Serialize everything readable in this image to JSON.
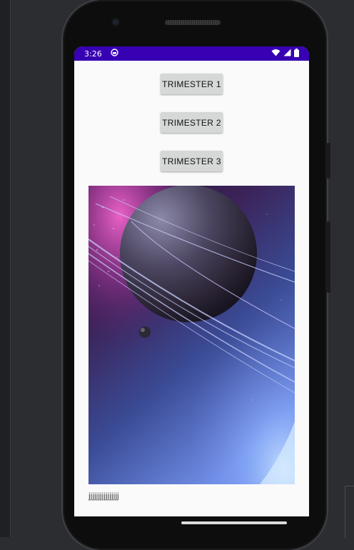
{
  "status_bar": {
    "time": "3:26",
    "bg_color": "#3700b3",
    "icons": [
      "notification-icon",
      "wifi-icon",
      "signal-icon",
      "battery-icon"
    ]
  },
  "buttons": [
    {
      "label": "TRIMESTER 1"
    },
    {
      "label": "TRIMESTER 2"
    },
    {
      "label": "TRIMESTER 3"
    }
  ],
  "caption": "jjjjjjjjjjjjjjjj"
}
